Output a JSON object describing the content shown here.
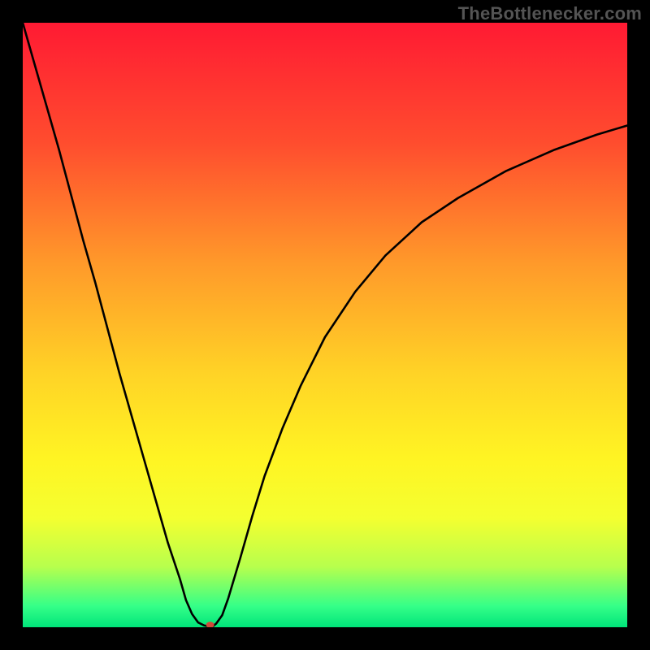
{
  "watermark": "TheBottleneсker.com",
  "chart_data": {
    "type": "line",
    "title": "",
    "xlabel": "",
    "ylabel": "",
    "xlim": [
      0,
      100
    ],
    "ylim": [
      0,
      100
    ],
    "grid": false,
    "background": {
      "type": "vertical-gradient",
      "stops": [
        {
          "offset": 0.0,
          "color": "#ff1a33"
        },
        {
          "offset": 0.2,
          "color": "#ff4d2e"
        },
        {
          "offset": 0.4,
          "color": "#ff9a2a"
        },
        {
          "offset": 0.58,
          "color": "#ffd326"
        },
        {
          "offset": 0.72,
          "color": "#fff423"
        },
        {
          "offset": 0.82,
          "color": "#f4ff30"
        },
        {
          "offset": 0.9,
          "color": "#b7ff4d"
        },
        {
          "offset": 0.965,
          "color": "#35ff88"
        },
        {
          "offset": 1.0,
          "color": "#00e57a"
        }
      ]
    },
    "series": [
      {
        "name": "bottleneck-curve",
        "x": [
          0.0,
          2,
          4,
          6,
          8,
          10,
          12,
          14,
          16,
          18,
          20,
          22,
          24,
          26,
          27,
          28,
          29,
          30,
          30.5,
          31.5,
          32,
          33,
          34,
          36,
          38,
          40,
          43,
          46,
          50,
          55,
          60,
          66,
          72,
          80,
          88,
          95,
          100
        ],
        "y": [
          100,
          93,
          86,
          79,
          71.5,
          64,
          57,
          49.5,
          42,
          35,
          28,
          21,
          14,
          8,
          4.5,
          2.2,
          0.8,
          0.3,
          0.2,
          0.2,
          0.6,
          2.0,
          4.8,
          11.5,
          18.5,
          25,
          33,
          40,
          48,
          55.5,
          61.5,
          67,
          71,
          75.5,
          79,
          81.5,
          83
        ]
      }
    ],
    "marker": {
      "x": 31,
      "y": 0.4,
      "color": "#d24a3a",
      "rx": 5.0,
      "ry": 3.8
    }
  }
}
